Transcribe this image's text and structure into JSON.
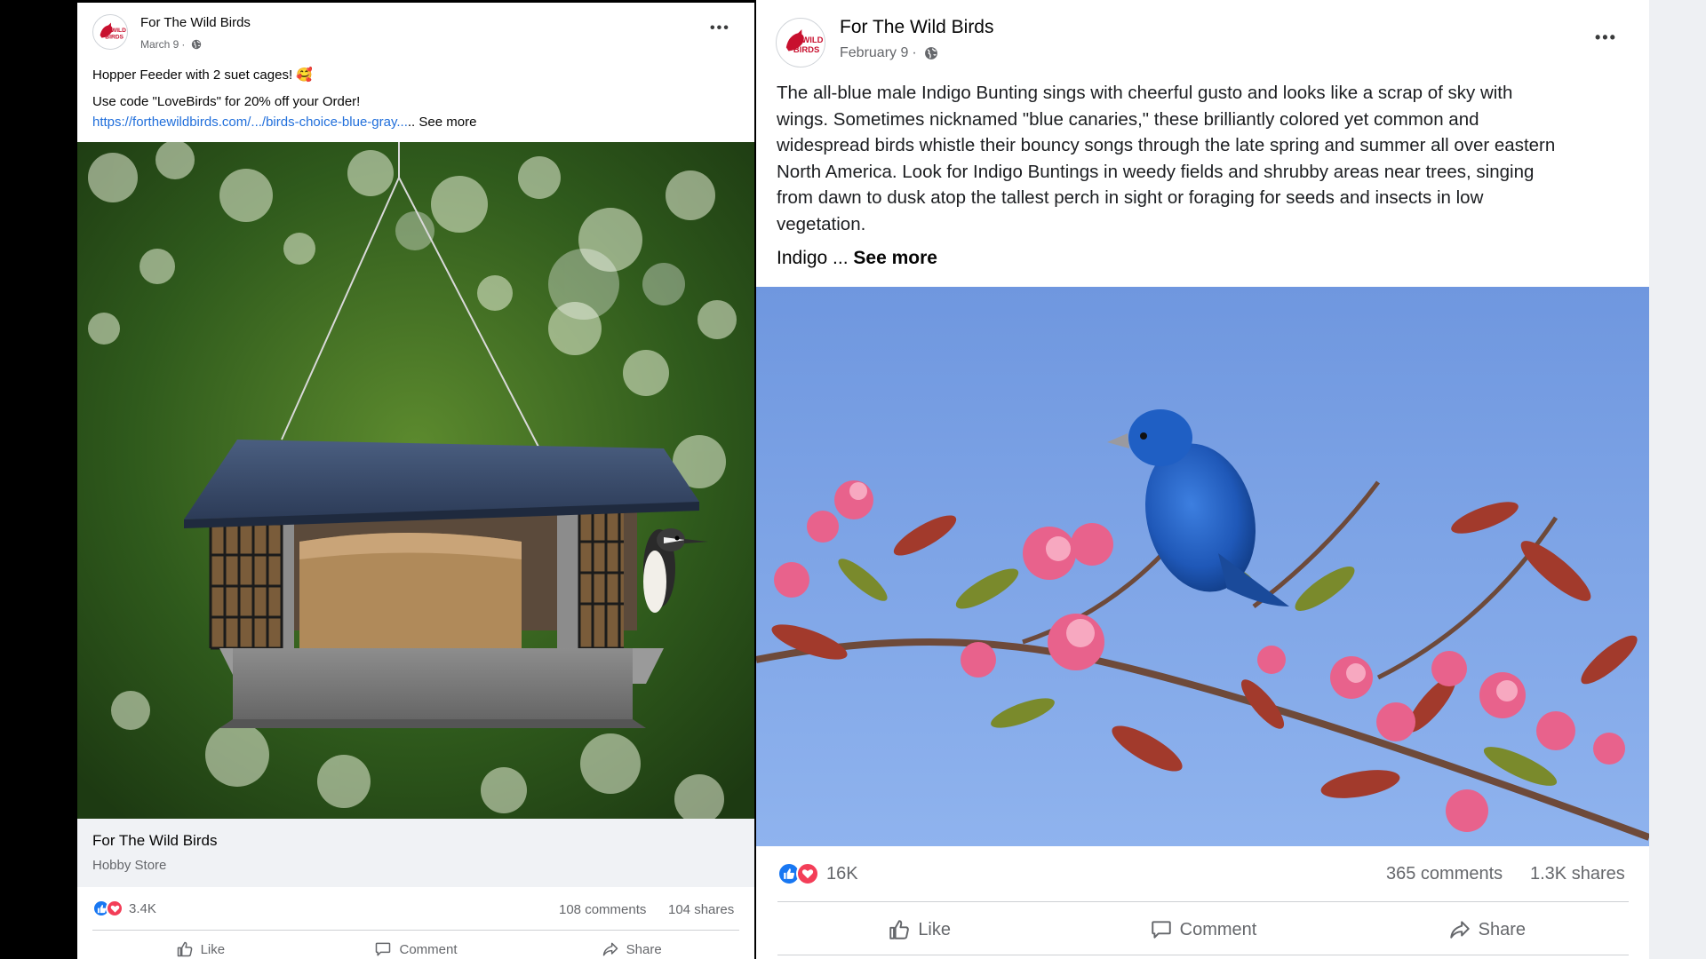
{
  "left_post": {
    "page_name": "For The Wild Birds",
    "date": "March 9",
    "text_line1": "Hopper Feeder with 2 suet cages! 🥰",
    "text_line2": "Use code \"LoveBirds\" for 20% off your Order!",
    "link_text": "https://forthewildbirds.com/.../birds-choice-blue-gray...",
    "ellipsis": "..",
    "see_more": "See more",
    "page_card_title": "For The Wild Birds",
    "page_card_category": "Hobby Store",
    "reaction_count": "3.4K",
    "comments": "108 comments",
    "shares": "104 shares",
    "actions": {
      "like": "Like",
      "comment": "Comment",
      "share": "Share"
    }
  },
  "right_post": {
    "page_name": "For The Wild Birds",
    "date": "February 9",
    "body_lines": [
      "The all-blue male Indigo Bunting sings with cheerful gusto and looks like a scrap of sky with",
      "wings. Sometimes nicknamed \"blue canaries,\" these brilliantly colored yet common and",
      "widespread birds whistle their bouncy songs through the late spring and summer all over eastern",
      "North America. Look for Indigo Buntings in weedy fields and shrubby areas near trees, singing",
      "from dawn to dusk atop the tallest perch in sight or foraging for seeds and insects in low",
      "vegetation."
    ],
    "tail_text": "Indigo ... ",
    "see_more": "See more",
    "reaction_count": "16K",
    "comments": "365 comments",
    "shares": "1.3K shares",
    "actions": {
      "like": "Like",
      "comment": "Comment",
      "share": "Share"
    }
  },
  "logo_text": {
    "line1": "WILD",
    "line2": "BIRDS"
  },
  "colors": {
    "link": "#216fdb",
    "secondary_text": "#65676b",
    "like_blue": "#1877f2",
    "love_red": "#f33e58",
    "logo_red": "#c8102e"
  },
  "icons": [
    "globe-icon",
    "more-options-icon",
    "like-reaction-icon",
    "love-reaction-icon",
    "thumbs-up-icon",
    "comment-icon",
    "share-icon"
  ]
}
